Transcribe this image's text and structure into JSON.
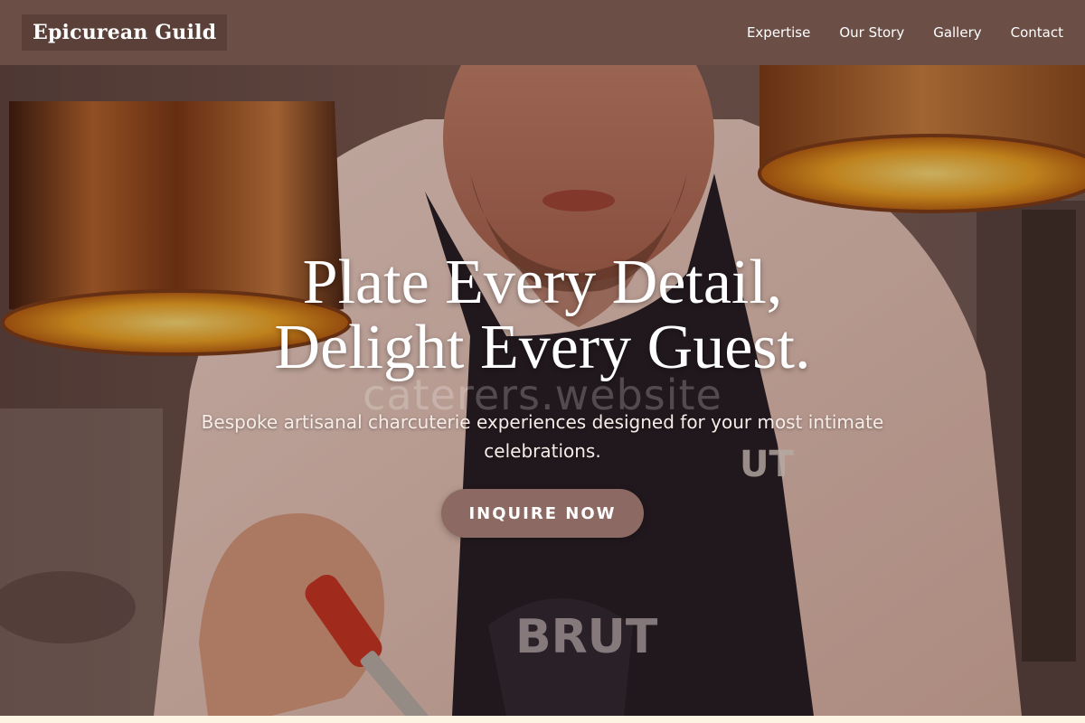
{
  "brand": {
    "name": "Epicurean Guild"
  },
  "nav": {
    "items": [
      {
        "label": "Expertise"
      },
      {
        "label": "Our Story"
      },
      {
        "label": "Gallery"
      },
      {
        "label": "Contact"
      }
    ]
  },
  "hero": {
    "title_line1": "Plate Every Detail,",
    "title_line2": "Delight Every Guest.",
    "watermark": "caterers.website",
    "subtitle": "Bespoke artisanal charcuterie experiences designed for your most intimate celebrations.",
    "cta_label": "INQUIRE NOW"
  },
  "colors": {
    "navbar": "#6b4f47",
    "brand_bg": "#5a4039",
    "cta": "#8c6a63",
    "page_bg": "#fbf3e4"
  }
}
